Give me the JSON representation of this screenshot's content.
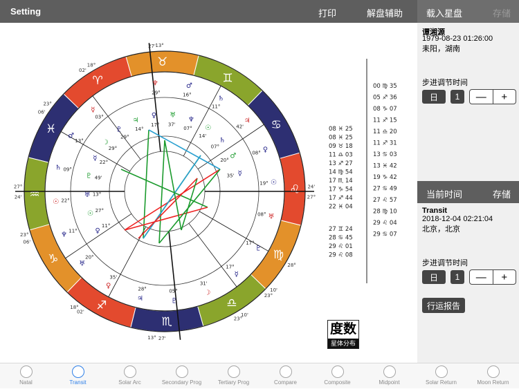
{
  "topbar": {
    "setting": "Setting",
    "print": "打印",
    "interpret": "解盘辅助",
    "load_chart": "载入星盘",
    "save": "存储"
  },
  "natal": {
    "name": "谭湘源",
    "datetime": "1979-08-23 01:26:00",
    "place": "耒阳，湖南",
    "step_label": "步进调节时间",
    "step_unit": "日",
    "step_value": "1",
    "minus": "—",
    "plus": "+"
  },
  "current": {
    "bar_title": "当前时间",
    "bar_save": "存储",
    "name": "Transit",
    "datetime": "2018-12-04 02:21:04",
    "place": "北京，北京",
    "step_label": "步进调节时间",
    "step_unit": "日",
    "step_value": "1",
    "minus": "—",
    "plus": "+",
    "report": "行运报告"
  },
  "badge": {
    "top": "度数",
    "bottom": "星体分布"
  },
  "wheel": {
    "outer_degrees": [
      "13°",
      "27'",
      "18°",
      "02'",
      "23°",
      "06'",
      "27°",
      "24'",
      "23°",
      "06'",
      "18°",
      "02'",
      "13°",
      "27'",
      "23°",
      "10'",
      "27°",
      "24'",
      "28°",
      "23°",
      "10'"
    ],
    "sign_colors": [
      "#e34a2e",
      "#2d2f72",
      "#8aa52c",
      "#e3912a",
      "#e34a2e",
      "#2d2f72",
      "#8aa52c",
      "#e3912a",
      "#e34a2e",
      "#2d2f72",
      "#8aa52c",
      "#e3912a"
    ],
    "signs": [
      "♈",
      "♓",
      "♒",
      "♑",
      "♐",
      "♏",
      "♎",
      "♍",
      "♌",
      "♋",
      "♊",
      "♉"
    ],
    "planet_labels_transit": [
      "29°",
      "16°",
      "11°",
      "42'",
      "08°",
      "19°",
      "08°",
      "17°",
      "17°",
      "31'",
      "05°",
      "28°",
      "35'",
      "20°",
      "11°",
      "22°",
      "09°",
      "13°",
      "03°"
    ],
    "planet_labels_natal": [
      "11°",
      "27°",
      "13°",
      "49'",
      "22°",
      "29°",
      "29°",
      "14°",
      "17°",
      "37'",
      "07°",
      "14'",
      "07°",
      "20°",
      "35'"
    ]
  },
  "aspect_table": {
    "left": [
      {
        "deg": "08",
        "sym": "♓",
        "min": "25"
      },
      {
        "deg": "08",
        "sym": "♓",
        "min": "25"
      },
      {
        "deg": "09",
        "sym": "♉",
        "min": "18"
      },
      {
        "deg": "11",
        "sym": "♎",
        "min": "03"
      },
      {
        "deg": "13",
        "sym": "♐",
        "min": "27"
      },
      {
        "deg": "14",
        "sym": "♍",
        "min": "54"
      },
      {
        "deg": "17",
        "sym": "♏",
        "min": "14"
      },
      {
        "deg": "17",
        "sym": "♑",
        "min": "54"
      },
      {
        "deg": "17",
        "sym": "♐",
        "min": "44"
      },
      {
        "deg": "22",
        "sym": "♓",
        "min": "04"
      },
      {
        "deg": "27",
        "sym": "♊",
        "min": "24"
      },
      {
        "deg": "28",
        "sym": "♋",
        "min": "45"
      },
      {
        "deg": "29",
        "sym": "♌",
        "min": "01"
      },
      {
        "deg": "29",
        "sym": "♌",
        "min": "08"
      }
    ],
    "right": [
      {
        "deg": "00",
        "sym": "♍",
        "min": "35"
      },
      {
        "deg": "05",
        "sym": "♐",
        "min": "36"
      },
      {
        "deg": "08",
        "sym": "♑",
        "min": "07"
      },
      {
        "deg": "11",
        "sym": "♐",
        "min": "15"
      },
      {
        "deg": "11",
        "sym": "♎",
        "min": "20"
      },
      {
        "deg": "11",
        "sym": "♐",
        "min": "31"
      },
      {
        "deg": "13",
        "sym": "♋",
        "min": "03"
      },
      {
        "deg": "13",
        "sym": "♓",
        "min": "42"
      },
      {
        "deg": "19",
        "sym": "♑",
        "min": "42"
      },
      {
        "deg": "27",
        "sym": "♋",
        "min": "49"
      },
      {
        "deg": "27",
        "sym": "♌",
        "min": "57"
      },
      {
        "deg": "28",
        "sym": "♍",
        "min": "10"
      },
      {
        "deg": "29",
        "sym": "♌",
        "min": "04"
      },
      {
        "deg": "29",
        "sym": "♋",
        "min": "07"
      }
    ]
  },
  "tabs": [
    {
      "label": "Natal",
      "active": false
    },
    {
      "label": "Transit",
      "active": true
    },
    {
      "label": "Solar Arc",
      "active": false
    },
    {
      "label": "Secondary Prog",
      "active": false
    },
    {
      "label": "Tertiary Prog",
      "active": false
    },
    {
      "label": "Compare",
      "active": false
    },
    {
      "label": "Composite",
      "active": false
    },
    {
      "label": "Midpoint",
      "active": false
    },
    {
      "label": "Solar Return",
      "active": false
    },
    {
      "label": "Moon Return",
      "active": false
    }
  ]
}
